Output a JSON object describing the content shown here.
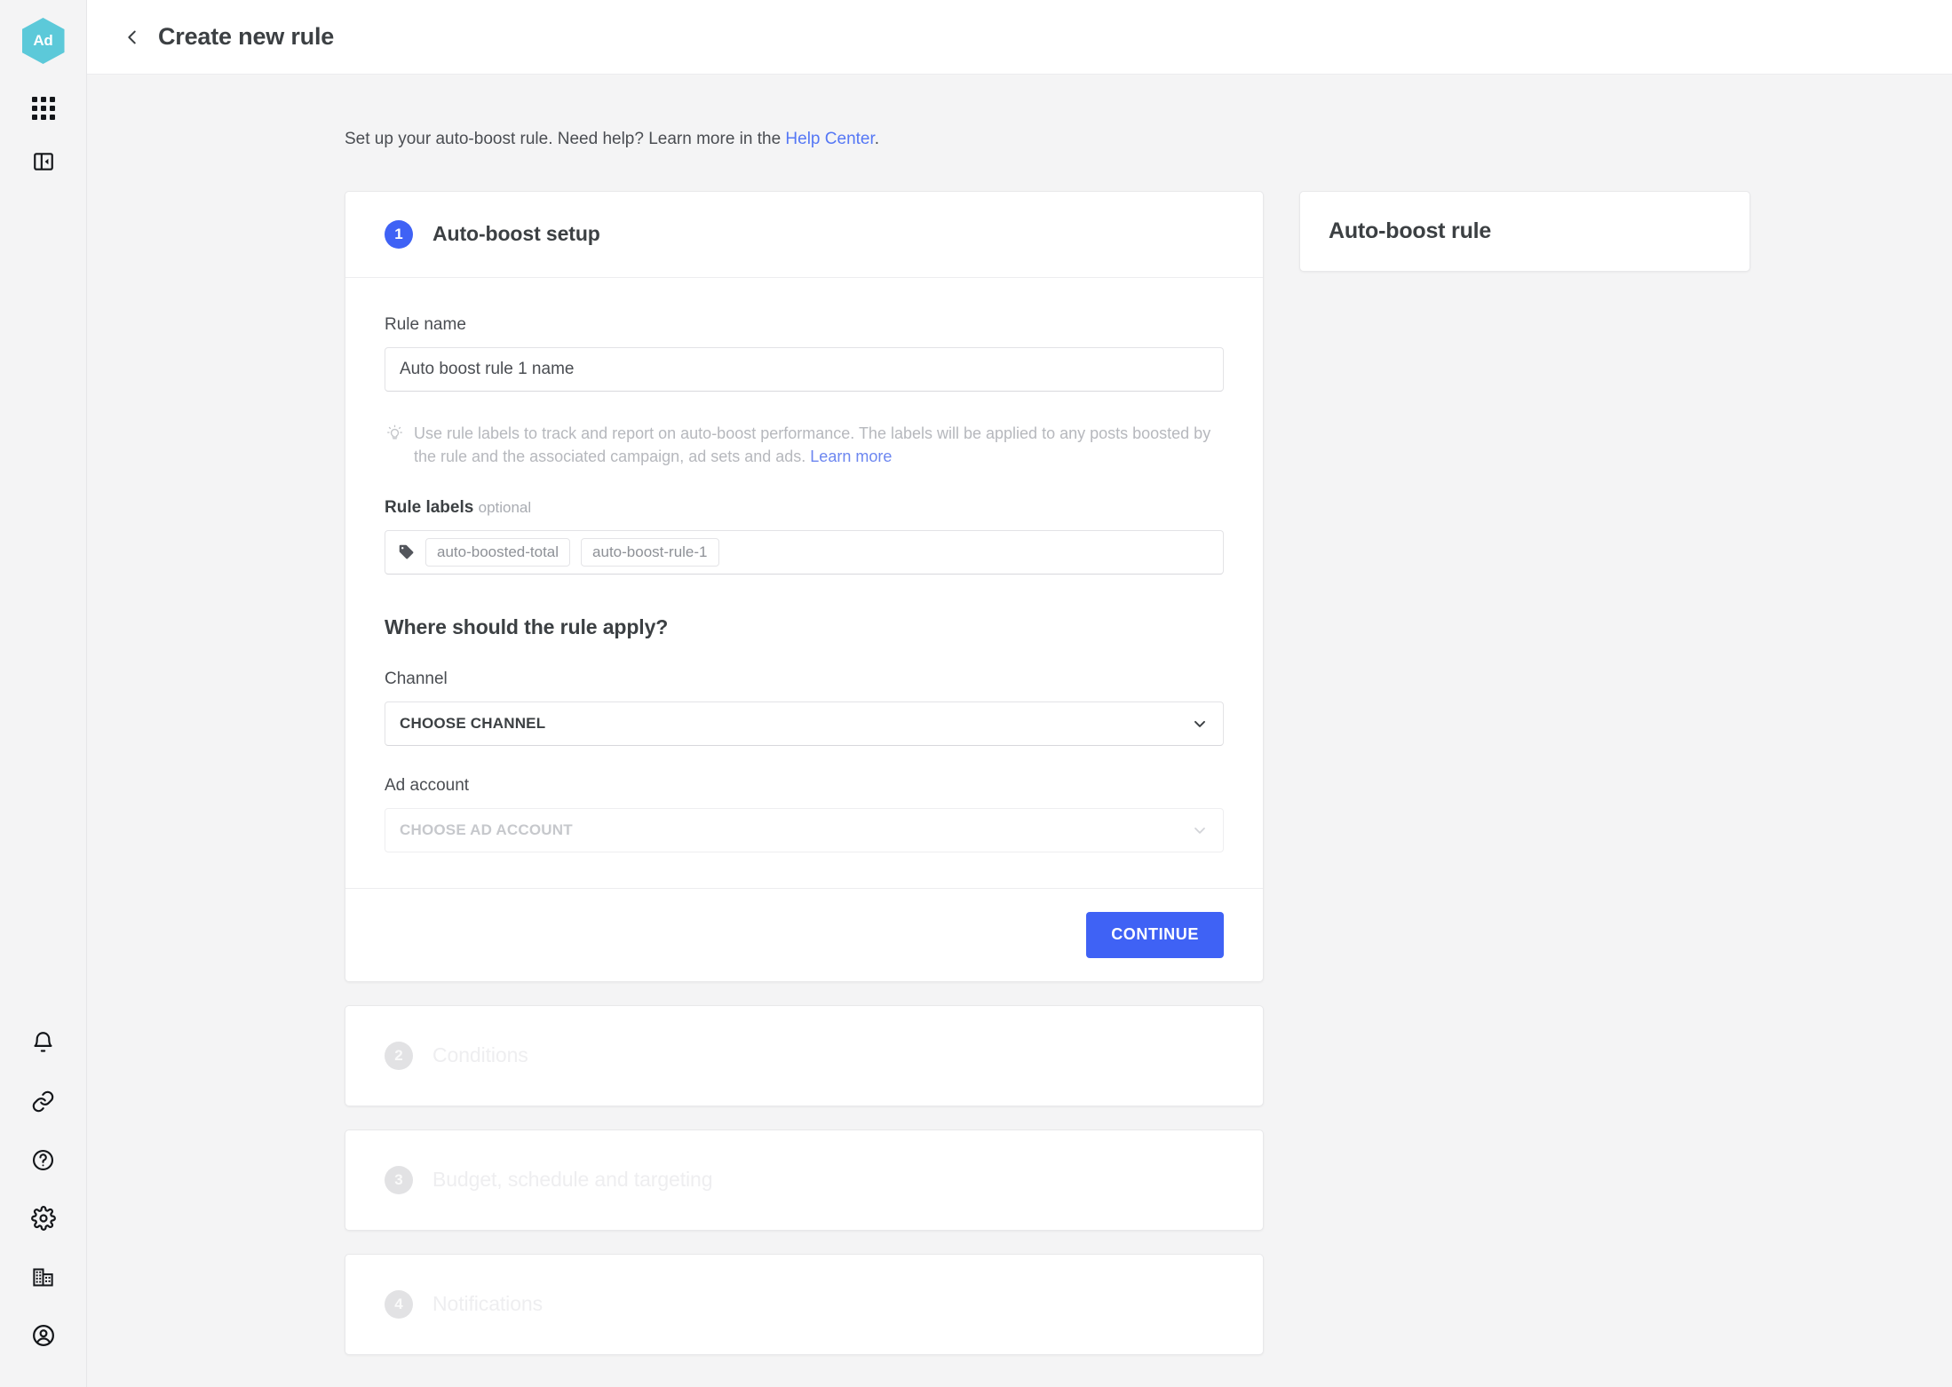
{
  "app": {
    "logo_text": "Ad",
    "logo_color": "#5cc9d9",
    "accent_color": "#3f62f5",
    "link_color": "#5577f5"
  },
  "rail": {
    "top_items": [
      {
        "name": "apps-grid-icon",
        "label": "Apps"
      },
      {
        "name": "collapse-sidebar-icon",
        "label": "Collapse sidebar"
      }
    ],
    "bottom_items": [
      {
        "name": "bell-icon",
        "label": "Notifications"
      },
      {
        "name": "link-icon",
        "label": "Links"
      },
      {
        "name": "help-icon",
        "label": "Help"
      },
      {
        "name": "gear-icon",
        "label": "Settings"
      },
      {
        "name": "building-icon",
        "label": "Organization"
      },
      {
        "name": "account-icon",
        "label": "Account"
      }
    ]
  },
  "header": {
    "back_label": "Back",
    "title": "Create new rule"
  },
  "intro": {
    "text_before": "Set up your auto-boost rule. Need help? Learn more in the ",
    "link_label": "Help Center",
    "text_after": "."
  },
  "step1": {
    "number": "1",
    "title": "Auto-boost setup",
    "rule_name": {
      "label": "Rule name",
      "value": "Auto boost rule 1 name",
      "placeholder": "Rule name"
    },
    "hint": {
      "icon": "lightbulb-icon",
      "text_before": "Use rule labels to track and report on auto-boost performance. The labels will be applied to any posts boosted by the rule and the associated campaign, ad sets and ads. ",
      "link_label": "Learn more"
    },
    "rule_labels": {
      "label": "Rule labels",
      "optional_label": "optional",
      "tag_icon": "tag-icon",
      "tags": [
        "auto-boosted-total",
        "auto-boost-rule-1"
      ]
    },
    "apply_section": {
      "title": "Where should the rule apply?",
      "channel": {
        "label": "Channel",
        "value": "CHOOSE CHANNEL",
        "disabled": false
      },
      "ad_account": {
        "label": "Ad account",
        "value": "CHOOSE AD ACCOUNT",
        "disabled": true
      }
    },
    "continue_label": "CONTINUE"
  },
  "steps": [
    {
      "number": "2",
      "title": "Conditions"
    },
    {
      "number": "3",
      "title": "Budget, schedule and targeting"
    },
    {
      "number": "4",
      "title": "Notifications"
    }
  ],
  "side_panel": {
    "title": "Auto-boost rule"
  }
}
